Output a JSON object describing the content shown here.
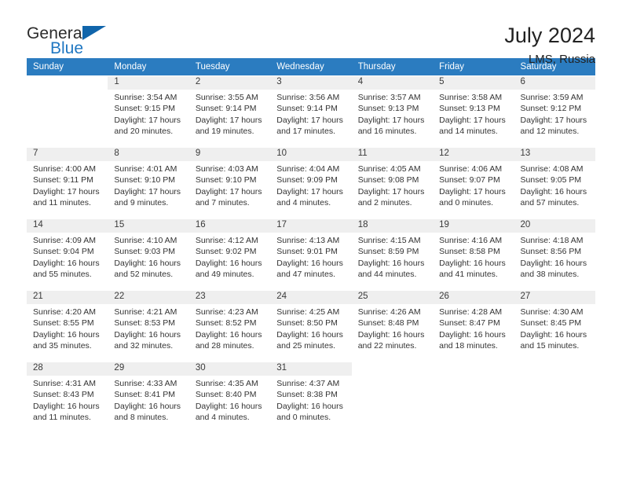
{
  "brand": {
    "name_part1": "General",
    "name_part2": "Blue",
    "flag_icon": "triangle-flag-icon",
    "accent_color": "#1065ab",
    "blue_text_color": "#1f77c2"
  },
  "header": {
    "title": "July 2024",
    "location": "LMS, Russia"
  },
  "calendar": {
    "header_bg": "#2b7cc0",
    "daynum_bg": "#efefef",
    "weekdays": [
      "Sunday",
      "Monday",
      "Tuesday",
      "Wednesday",
      "Thursday",
      "Friday",
      "Saturday"
    ],
    "weeks": [
      [
        {
          "day": ""
        },
        {
          "day": "1",
          "sunrise": "Sunrise: 3:54 AM",
          "sunset": "Sunset: 9:15 PM",
          "daylight_line1": "Daylight: 17 hours",
          "daylight_line2": "and 20 minutes."
        },
        {
          "day": "2",
          "sunrise": "Sunrise: 3:55 AM",
          "sunset": "Sunset: 9:14 PM",
          "daylight_line1": "Daylight: 17 hours",
          "daylight_line2": "and 19 minutes."
        },
        {
          "day": "3",
          "sunrise": "Sunrise: 3:56 AM",
          "sunset": "Sunset: 9:14 PM",
          "daylight_line1": "Daylight: 17 hours",
          "daylight_line2": "and 17 minutes."
        },
        {
          "day": "4",
          "sunrise": "Sunrise: 3:57 AM",
          "sunset": "Sunset: 9:13 PM",
          "daylight_line1": "Daylight: 17 hours",
          "daylight_line2": "and 16 minutes."
        },
        {
          "day": "5",
          "sunrise": "Sunrise: 3:58 AM",
          "sunset": "Sunset: 9:13 PM",
          "daylight_line1": "Daylight: 17 hours",
          "daylight_line2": "and 14 minutes."
        },
        {
          "day": "6",
          "sunrise": "Sunrise: 3:59 AM",
          "sunset": "Sunset: 9:12 PM",
          "daylight_line1": "Daylight: 17 hours",
          "daylight_line2": "and 12 minutes."
        }
      ],
      [
        {
          "day": "7",
          "sunrise": "Sunrise: 4:00 AM",
          "sunset": "Sunset: 9:11 PM",
          "daylight_line1": "Daylight: 17 hours",
          "daylight_line2": "and 11 minutes."
        },
        {
          "day": "8",
          "sunrise": "Sunrise: 4:01 AM",
          "sunset": "Sunset: 9:10 PM",
          "daylight_line1": "Daylight: 17 hours",
          "daylight_line2": "and 9 minutes."
        },
        {
          "day": "9",
          "sunrise": "Sunrise: 4:03 AM",
          "sunset": "Sunset: 9:10 PM",
          "daylight_line1": "Daylight: 17 hours",
          "daylight_line2": "and 7 minutes."
        },
        {
          "day": "10",
          "sunrise": "Sunrise: 4:04 AM",
          "sunset": "Sunset: 9:09 PM",
          "daylight_line1": "Daylight: 17 hours",
          "daylight_line2": "and 4 minutes."
        },
        {
          "day": "11",
          "sunrise": "Sunrise: 4:05 AM",
          "sunset": "Sunset: 9:08 PM",
          "daylight_line1": "Daylight: 17 hours",
          "daylight_line2": "and 2 minutes."
        },
        {
          "day": "12",
          "sunrise": "Sunrise: 4:06 AM",
          "sunset": "Sunset: 9:07 PM",
          "daylight_line1": "Daylight: 17 hours",
          "daylight_line2": "and 0 minutes."
        },
        {
          "day": "13",
          "sunrise": "Sunrise: 4:08 AM",
          "sunset": "Sunset: 9:05 PM",
          "daylight_line1": "Daylight: 16 hours",
          "daylight_line2": "and 57 minutes."
        }
      ],
      [
        {
          "day": "14",
          "sunrise": "Sunrise: 4:09 AM",
          "sunset": "Sunset: 9:04 PM",
          "daylight_line1": "Daylight: 16 hours",
          "daylight_line2": "and 55 minutes."
        },
        {
          "day": "15",
          "sunrise": "Sunrise: 4:10 AM",
          "sunset": "Sunset: 9:03 PM",
          "daylight_line1": "Daylight: 16 hours",
          "daylight_line2": "and 52 minutes."
        },
        {
          "day": "16",
          "sunrise": "Sunrise: 4:12 AM",
          "sunset": "Sunset: 9:02 PM",
          "daylight_line1": "Daylight: 16 hours",
          "daylight_line2": "and 49 minutes."
        },
        {
          "day": "17",
          "sunrise": "Sunrise: 4:13 AM",
          "sunset": "Sunset: 9:01 PM",
          "daylight_line1": "Daylight: 16 hours",
          "daylight_line2": "and 47 minutes."
        },
        {
          "day": "18",
          "sunrise": "Sunrise: 4:15 AM",
          "sunset": "Sunset: 8:59 PM",
          "daylight_line1": "Daylight: 16 hours",
          "daylight_line2": "and 44 minutes."
        },
        {
          "day": "19",
          "sunrise": "Sunrise: 4:16 AM",
          "sunset": "Sunset: 8:58 PM",
          "daylight_line1": "Daylight: 16 hours",
          "daylight_line2": "and 41 minutes."
        },
        {
          "day": "20",
          "sunrise": "Sunrise: 4:18 AM",
          "sunset": "Sunset: 8:56 PM",
          "daylight_line1": "Daylight: 16 hours",
          "daylight_line2": "and 38 minutes."
        }
      ],
      [
        {
          "day": "21",
          "sunrise": "Sunrise: 4:20 AM",
          "sunset": "Sunset: 8:55 PM",
          "daylight_line1": "Daylight: 16 hours",
          "daylight_line2": "and 35 minutes."
        },
        {
          "day": "22",
          "sunrise": "Sunrise: 4:21 AM",
          "sunset": "Sunset: 8:53 PM",
          "daylight_line1": "Daylight: 16 hours",
          "daylight_line2": "and 32 minutes."
        },
        {
          "day": "23",
          "sunrise": "Sunrise: 4:23 AM",
          "sunset": "Sunset: 8:52 PM",
          "daylight_line1": "Daylight: 16 hours",
          "daylight_line2": "and 28 minutes."
        },
        {
          "day": "24",
          "sunrise": "Sunrise: 4:25 AM",
          "sunset": "Sunset: 8:50 PM",
          "daylight_line1": "Daylight: 16 hours",
          "daylight_line2": "and 25 minutes."
        },
        {
          "day": "25",
          "sunrise": "Sunrise: 4:26 AM",
          "sunset": "Sunset: 8:48 PM",
          "daylight_line1": "Daylight: 16 hours",
          "daylight_line2": "and 22 minutes."
        },
        {
          "day": "26",
          "sunrise": "Sunrise: 4:28 AM",
          "sunset": "Sunset: 8:47 PM",
          "daylight_line1": "Daylight: 16 hours",
          "daylight_line2": "and 18 minutes."
        },
        {
          "day": "27",
          "sunrise": "Sunrise: 4:30 AM",
          "sunset": "Sunset: 8:45 PM",
          "daylight_line1": "Daylight: 16 hours",
          "daylight_line2": "and 15 minutes."
        }
      ],
      [
        {
          "day": "28",
          "sunrise": "Sunrise: 4:31 AM",
          "sunset": "Sunset: 8:43 PM",
          "daylight_line1": "Daylight: 16 hours",
          "daylight_line2": "and 11 minutes."
        },
        {
          "day": "29",
          "sunrise": "Sunrise: 4:33 AM",
          "sunset": "Sunset: 8:41 PM",
          "daylight_line1": "Daylight: 16 hours",
          "daylight_line2": "and 8 minutes."
        },
        {
          "day": "30",
          "sunrise": "Sunrise: 4:35 AM",
          "sunset": "Sunset: 8:40 PM",
          "daylight_line1": "Daylight: 16 hours",
          "daylight_line2": "and 4 minutes."
        },
        {
          "day": "31",
          "sunrise": "Sunrise: 4:37 AM",
          "sunset": "Sunset: 8:38 PM",
          "daylight_line1": "Daylight: 16 hours",
          "daylight_line2": "and 0 minutes."
        },
        {
          "day": ""
        },
        {
          "day": ""
        },
        {
          "day": ""
        }
      ]
    ]
  }
}
